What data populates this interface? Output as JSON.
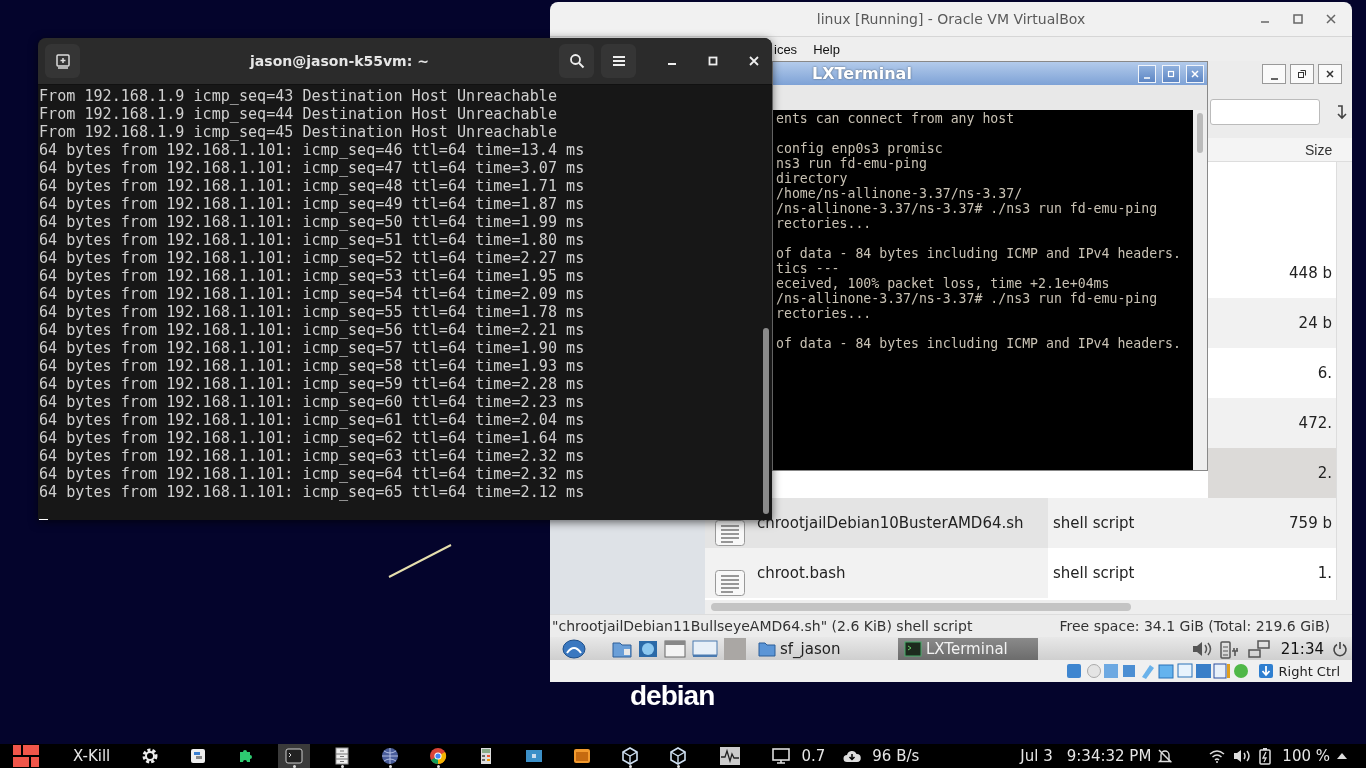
{
  "desktop": {
    "logo_text": "debian"
  },
  "host_terminal": {
    "title": "jason@jason-k55vm: ~",
    "lines": [
      "From 192.168.1.9 icmp_seq=43 Destination Host Unreachable",
      "From 192.168.1.9 icmp_seq=44 Destination Host Unreachable",
      "From 192.168.1.9 icmp_seq=45 Destination Host Unreachable",
      "64 bytes from 192.168.1.101: icmp_seq=46 ttl=64 time=13.4 ms",
      "64 bytes from 192.168.1.101: icmp_seq=47 ttl=64 time=3.07 ms",
      "64 bytes from 192.168.1.101: icmp_seq=48 ttl=64 time=1.71 ms",
      "64 bytes from 192.168.1.101: icmp_seq=49 ttl=64 time=1.87 ms",
      "64 bytes from 192.168.1.101: icmp_seq=50 ttl=64 time=1.99 ms",
      "64 bytes from 192.168.1.101: icmp_seq=51 ttl=64 time=1.80 ms",
      "64 bytes from 192.168.1.101: icmp_seq=52 ttl=64 time=2.27 ms",
      "64 bytes from 192.168.1.101: icmp_seq=53 ttl=64 time=1.95 ms",
      "64 bytes from 192.168.1.101: icmp_seq=54 ttl=64 time=2.09 ms",
      "64 bytes from 192.168.1.101: icmp_seq=55 ttl=64 time=1.78 ms",
      "64 bytes from 192.168.1.101: icmp_seq=56 ttl=64 time=2.21 ms",
      "64 bytes from 192.168.1.101: icmp_seq=57 ttl=64 time=1.90 ms",
      "64 bytes from 192.168.1.101: icmp_seq=58 ttl=64 time=1.93 ms",
      "64 bytes from 192.168.1.101: icmp_seq=59 ttl=64 time=2.28 ms",
      "64 bytes from 192.168.1.101: icmp_seq=60 ttl=64 time=2.23 ms",
      "64 bytes from 192.168.1.101: icmp_seq=61 ttl=64 time=2.04 ms",
      "64 bytes from 192.168.1.101: icmp_seq=62 ttl=64 time=1.64 ms",
      "64 bytes from 192.168.1.101: icmp_seq=63 ttl=64 time=2.32 ms",
      "64 bytes from 192.168.1.101: icmp_seq=64 ttl=64 time=2.32 ms",
      "64 bytes from 192.168.1.101: icmp_seq=65 ttl=64 time=2.12 ms"
    ]
  },
  "virtualbox": {
    "title": "linux [Running] - Oracle VM VirtualBox",
    "menu": [
      "ices",
      "Help"
    ],
    "file_manager": {
      "column_header": "Size",
      "rows": [
        {
          "selected": false
        },
        {
          "selected": false
        },
        {
          "size": "448 b",
          "selected": false
        },
        {
          "size": "24 b",
          "selected": false
        },
        {
          "size": "6.",
          "selected": false
        },
        {
          "size": "472.",
          "selected": false
        },
        {
          "size": "2.",
          "selected": true
        },
        {
          "name": "chrootjailDebian10BusterAMD64.sh",
          "type": "shell script",
          "size": "759 b",
          "selected": false
        },
        {
          "name": "chroot.bash",
          "type": "shell script",
          "size": "1.",
          "selected": false
        }
      ],
      "status_left": "\"chrootjailDebian11BullseyeAMD64.sh\" (2.6 KiB) shell script",
      "status_right": "Free space: 34.1 GiB (Total: 219.6 GiB)"
    },
    "lxterminal": {
      "title": "LXTerminal",
      "blocks": [
        [
          "ents can connect from any host"
        ],
        [
          "config enp0s3 promisc",
          "ns3 run fd-emu-ping",
          "directory",
          "/home/ns-allinone-3.37/ns-3.37/",
          "/ns-allinone-3.37/ns-3.37# ./ns3 run fd-emu-ping",
          "rectories..."
        ],
        [
          "of data - 84 bytes including ICMP and IPv4 headers.",
          "tics ---",
          "eceived, 100% packet loss, time +2.1e+04ms",
          "/ns-allinone-3.37/ns-3.37# ./ns3 run fd-emu-ping",
          "rectories..."
        ],
        [
          "of data - 84 bytes including ICMP and IPv4 headers."
        ]
      ]
    },
    "guest_panel": {
      "tasks": [
        {
          "label": "sf_jason",
          "kind": "folder",
          "selected": false
        },
        {
          "label": "LXTerminal",
          "kind": "terminal",
          "selected": true
        }
      ],
      "clock": "21:34"
    },
    "status_bar": {
      "host_key": "Right Ctrl"
    }
  },
  "taskbar": {
    "launcher_label": "X-Kill",
    "apps": [
      {
        "kind": "gear",
        "selected": false,
        "running": false
      },
      {
        "kind": "window",
        "selected": false,
        "running": false
      },
      {
        "kind": "puzzle",
        "selected": false,
        "running": false
      },
      {
        "kind": "terminal",
        "selected": true,
        "running": true
      },
      {
        "kind": "cabinet",
        "selected": false,
        "running": true
      },
      {
        "kind": "globe",
        "selected": false,
        "running": true
      },
      {
        "kind": "browser",
        "selected": false,
        "running": true
      },
      {
        "kind": "calculator",
        "selected": false,
        "running": false
      },
      {
        "kind": "screen",
        "selected": false,
        "running": false
      },
      {
        "kind": "box",
        "selected": false,
        "running": false
      },
      {
        "kind": "cube",
        "selected": false,
        "running": true
      },
      {
        "kind": "cube",
        "selected": false,
        "running": true
      }
    ],
    "load": "0.7",
    "network": "96 B/s",
    "date": "Jul 3",
    "time": "9:34:32 PM",
    "battery": "100 %"
  }
}
